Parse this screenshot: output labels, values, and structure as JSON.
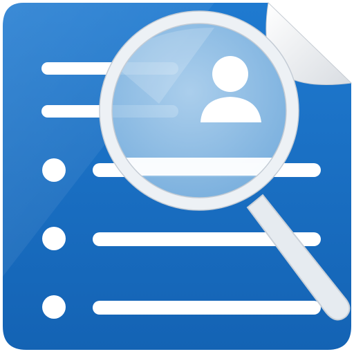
{
  "icon": {
    "name": "document-user-search-icon",
    "colors": {
      "background": "#ffffff",
      "document_blue": "#1a6fc4",
      "document_blue_dark": "#1463b4",
      "lines": "#ffffff",
      "lens_glass": "#9cc6e8",
      "lens_rim": "#e9eef3",
      "person": "#ffffff",
      "page_curl": "#f3f3f3"
    },
    "list_rows": 5,
    "bulleted_rows": 3
  }
}
